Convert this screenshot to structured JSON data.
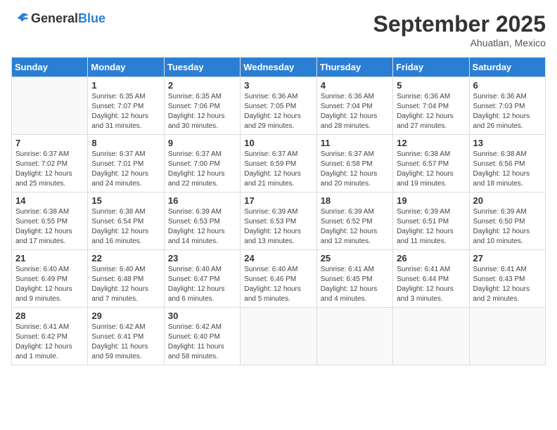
{
  "header": {
    "logo_general": "General",
    "logo_blue": "Blue",
    "month": "September 2025",
    "location": "Ahuatlan, Mexico"
  },
  "days_of_week": [
    "Sunday",
    "Monday",
    "Tuesday",
    "Wednesday",
    "Thursday",
    "Friday",
    "Saturday"
  ],
  "weeks": [
    [
      {
        "day": "",
        "info": ""
      },
      {
        "day": "1",
        "info": "Sunrise: 6:35 AM\nSunset: 7:07 PM\nDaylight: 12 hours\nand 31 minutes."
      },
      {
        "day": "2",
        "info": "Sunrise: 6:35 AM\nSunset: 7:06 PM\nDaylight: 12 hours\nand 30 minutes."
      },
      {
        "day": "3",
        "info": "Sunrise: 6:36 AM\nSunset: 7:05 PM\nDaylight: 12 hours\nand 29 minutes."
      },
      {
        "day": "4",
        "info": "Sunrise: 6:36 AM\nSunset: 7:04 PM\nDaylight: 12 hours\nand 28 minutes."
      },
      {
        "day": "5",
        "info": "Sunrise: 6:36 AM\nSunset: 7:04 PM\nDaylight: 12 hours\nand 27 minutes."
      },
      {
        "day": "6",
        "info": "Sunrise: 6:36 AM\nSunset: 7:03 PM\nDaylight: 12 hours\nand 26 minutes."
      }
    ],
    [
      {
        "day": "7",
        "info": "Sunrise: 6:37 AM\nSunset: 7:02 PM\nDaylight: 12 hours\nand 25 minutes."
      },
      {
        "day": "8",
        "info": "Sunrise: 6:37 AM\nSunset: 7:01 PM\nDaylight: 12 hours\nand 24 minutes."
      },
      {
        "day": "9",
        "info": "Sunrise: 6:37 AM\nSunset: 7:00 PM\nDaylight: 12 hours\nand 22 minutes."
      },
      {
        "day": "10",
        "info": "Sunrise: 6:37 AM\nSunset: 6:59 PM\nDaylight: 12 hours\nand 21 minutes."
      },
      {
        "day": "11",
        "info": "Sunrise: 6:37 AM\nSunset: 6:58 PM\nDaylight: 12 hours\nand 20 minutes."
      },
      {
        "day": "12",
        "info": "Sunrise: 6:38 AM\nSunset: 6:57 PM\nDaylight: 12 hours\nand 19 minutes."
      },
      {
        "day": "13",
        "info": "Sunrise: 6:38 AM\nSunset: 6:56 PM\nDaylight: 12 hours\nand 18 minutes."
      }
    ],
    [
      {
        "day": "14",
        "info": "Sunrise: 6:38 AM\nSunset: 6:55 PM\nDaylight: 12 hours\nand 17 minutes."
      },
      {
        "day": "15",
        "info": "Sunrise: 6:38 AM\nSunset: 6:54 PM\nDaylight: 12 hours\nand 16 minutes."
      },
      {
        "day": "16",
        "info": "Sunrise: 6:39 AM\nSunset: 6:53 PM\nDaylight: 12 hours\nand 14 minutes."
      },
      {
        "day": "17",
        "info": "Sunrise: 6:39 AM\nSunset: 6:53 PM\nDaylight: 12 hours\nand 13 minutes."
      },
      {
        "day": "18",
        "info": "Sunrise: 6:39 AM\nSunset: 6:52 PM\nDaylight: 12 hours\nand 12 minutes."
      },
      {
        "day": "19",
        "info": "Sunrise: 6:39 AM\nSunset: 6:51 PM\nDaylight: 12 hours\nand 11 minutes."
      },
      {
        "day": "20",
        "info": "Sunrise: 6:39 AM\nSunset: 6:50 PM\nDaylight: 12 hours\nand 10 minutes."
      }
    ],
    [
      {
        "day": "21",
        "info": "Sunrise: 6:40 AM\nSunset: 6:49 PM\nDaylight: 12 hours\nand 9 minutes."
      },
      {
        "day": "22",
        "info": "Sunrise: 6:40 AM\nSunset: 6:48 PM\nDaylight: 12 hours\nand 7 minutes."
      },
      {
        "day": "23",
        "info": "Sunrise: 6:40 AM\nSunset: 6:47 PM\nDaylight: 12 hours\nand 6 minutes."
      },
      {
        "day": "24",
        "info": "Sunrise: 6:40 AM\nSunset: 6:46 PM\nDaylight: 12 hours\nand 5 minutes."
      },
      {
        "day": "25",
        "info": "Sunrise: 6:41 AM\nSunset: 6:45 PM\nDaylight: 12 hours\nand 4 minutes."
      },
      {
        "day": "26",
        "info": "Sunrise: 6:41 AM\nSunset: 6:44 PM\nDaylight: 12 hours\nand 3 minutes."
      },
      {
        "day": "27",
        "info": "Sunrise: 6:41 AM\nSunset: 6:43 PM\nDaylight: 12 hours\nand 2 minutes."
      }
    ],
    [
      {
        "day": "28",
        "info": "Sunrise: 6:41 AM\nSunset: 6:42 PM\nDaylight: 12 hours\nand 1 minute."
      },
      {
        "day": "29",
        "info": "Sunrise: 6:42 AM\nSunset: 6:41 PM\nDaylight: 11 hours\nand 59 minutes."
      },
      {
        "day": "30",
        "info": "Sunrise: 6:42 AM\nSunset: 6:40 PM\nDaylight: 11 hours\nand 58 minutes."
      },
      {
        "day": "",
        "info": ""
      },
      {
        "day": "",
        "info": ""
      },
      {
        "day": "",
        "info": ""
      },
      {
        "day": "",
        "info": ""
      }
    ]
  ]
}
